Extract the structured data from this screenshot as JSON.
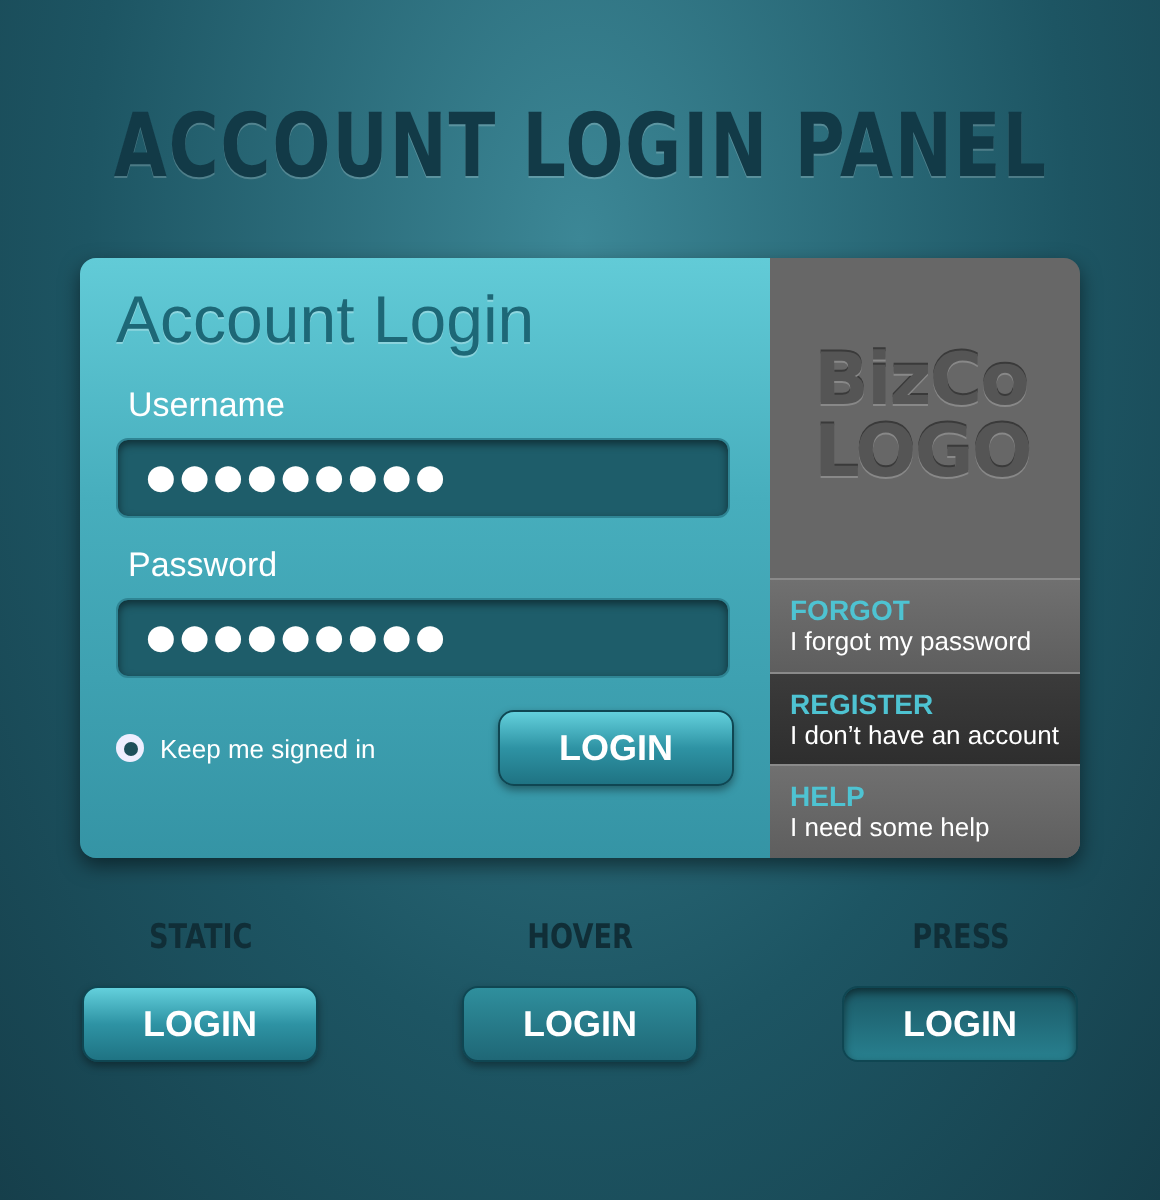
{
  "title": "ACCOUNT LOGIN PANEL",
  "login": {
    "heading": "Account Login",
    "fields": [
      {
        "label": "Username",
        "value": "●●●●●●●●●"
      },
      {
        "label": "Password",
        "value": "●●●●●●●●●"
      }
    ],
    "remember": {
      "label": "Keep me signed in",
      "checked": true
    },
    "button": "LOGIN"
  },
  "side": {
    "logo": [
      "BizCo",
      "LOGO"
    ],
    "links": [
      {
        "title": "FORGOT",
        "text": "I forgot my password",
        "selected": false
      },
      {
        "title": "REGISTER",
        "text": "I don’t have an account",
        "selected": true
      },
      {
        "title": "HELP",
        "text": "I need some help",
        "selected": false
      }
    ]
  },
  "states": [
    {
      "kind": "static",
      "label": "STATIC",
      "button": "LOGIN"
    },
    {
      "kind": "hover",
      "label": "HOVER",
      "button": "LOGIN"
    },
    {
      "kind": "press",
      "label": "PRESS",
      "button": "LOGIN"
    }
  ]
}
